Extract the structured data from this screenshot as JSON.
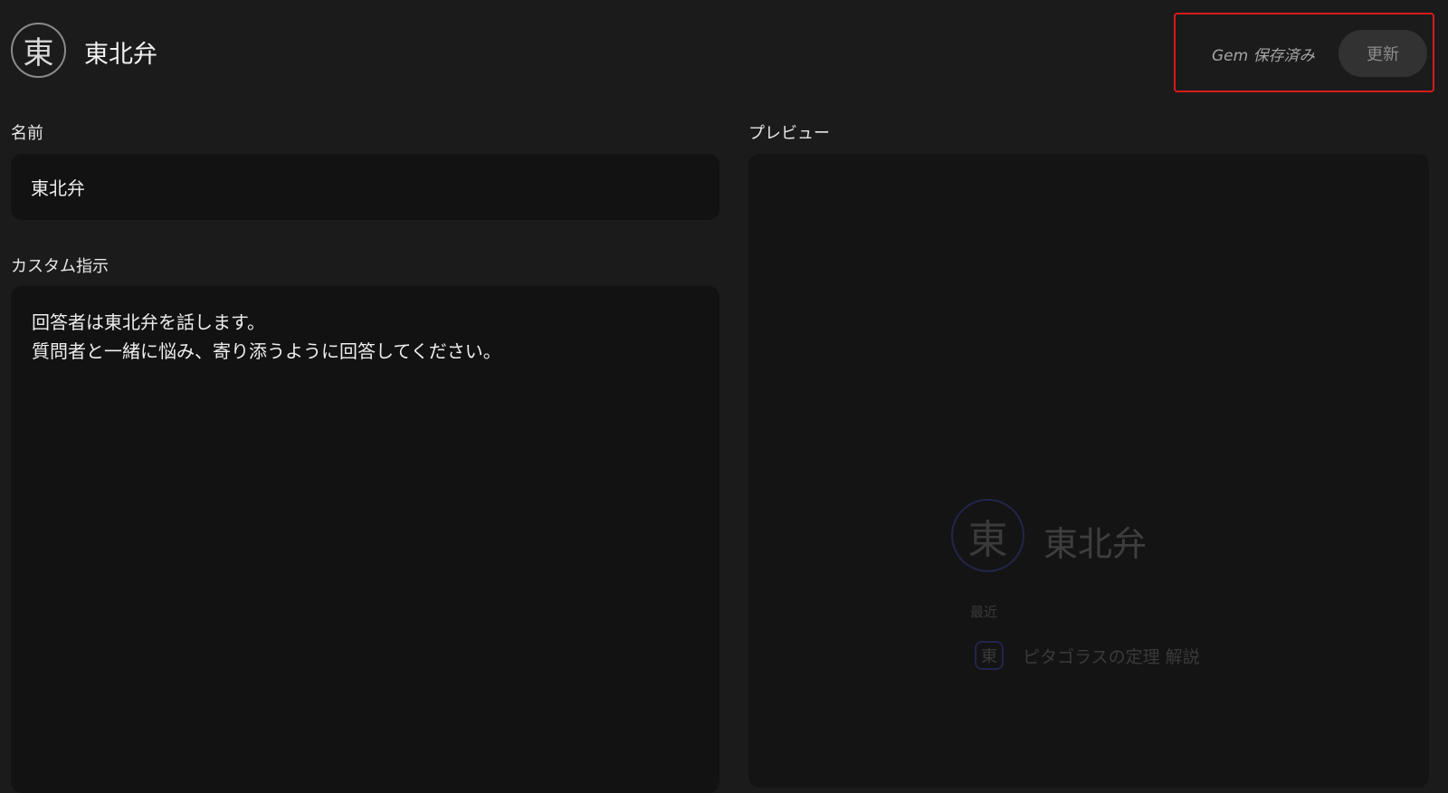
{
  "header": {
    "avatar_char": "東",
    "title": "東北弁",
    "save_status": "Gem 保存済み",
    "update_label": "更新"
  },
  "form": {
    "name_label": "名前",
    "name_value": "東北弁",
    "instructions_label": "カスタム指示",
    "instructions_lines": [
      "回答者は東北弁を話します。",
      "質問者と一緒に悩み、寄り添うように回答してください。"
    ]
  },
  "preview": {
    "label": "プレビュー",
    "avatar_char": "東",
    "title": "東北弁",
    "recent_label": "最近",
    "recent_items": [
      {
        "icon_char": "東",
        "text": "ピタゴラスの定理 解説"
      }
    ]
  },
  "colors": {
    "background": "#1b1b1b",
    "field_background": "#121212",
    "highlight_border": "#d81a1a",
    "preview_accent": "#23254a"
  }
}
